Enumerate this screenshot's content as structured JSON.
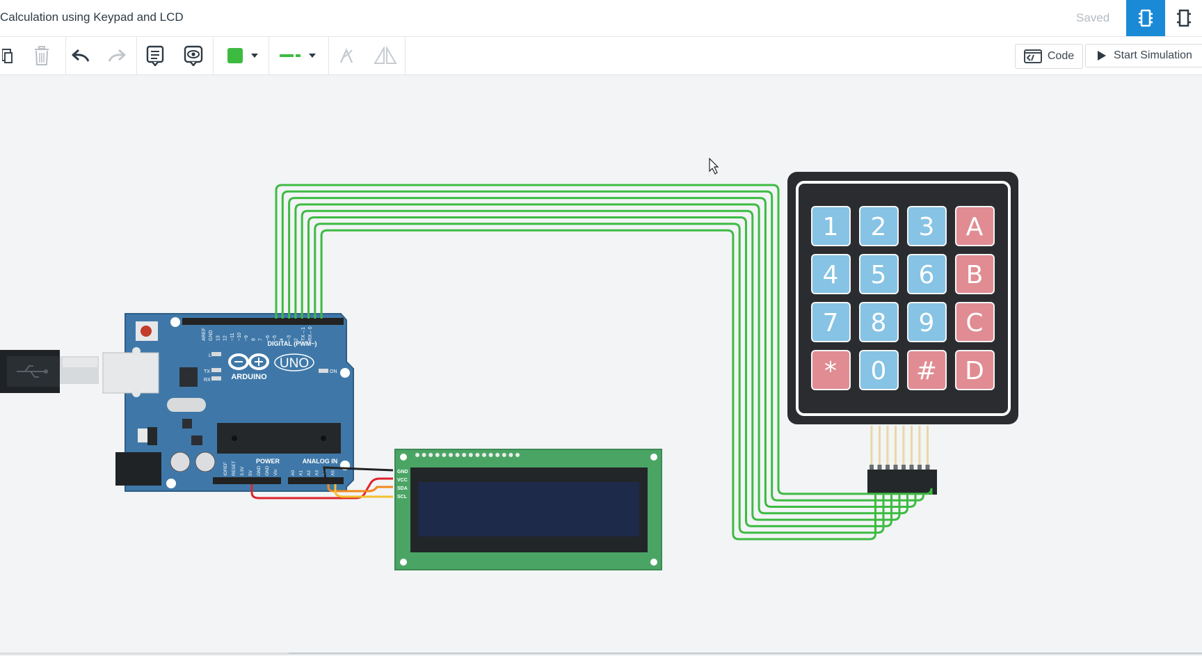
{
  "header": {
    "title": "Calculation using Keypad and LCD",
    "save_status": "Saved"
  },
  "toolbar": {
    "code_label": "Code",
    "simulate_label": "Start Simulation",
    "fill_color": "#3dbb41",
    "wire_color": "#3dbb41"
  },
  "arduino": {
    "brand": "ARDUINO",
    "model": "UNO",
    "digital_label": "DIGITAL (PWM~)",
    "power_label": "POWER",
    "analog_label": "ANALOG IN",
    "led_l": "L",
    "led_tx": "TX",
    "led_rx": "RX",
    "on_label": "ON",
    "digital_pins": [
      "AREF",
      "GND",
      "13",
      "12",
      "~11",
      "~10",
      "~9",
      "8",
      "7",
      "~6",
      "~5",
      "4",
      "~3",
      "2",
      "TX→1",
      "RX←0"
    ],
    "power_pins": [
      "IOREF",
      "RESET",
      "3.3V",
      "5V",
      "GND",
      "GND",
      "Vin"
    ],
    "analog_pins": [
      "A0",
      "A1",
      "A2",
      "A3",
      "A4",
      "A5"
    ]
  },
  "lcd": {
    "pins": [
      "GND",
      "VCC",
      "SDA",
      "SCL"
    ]
  },
  "keypad": {
    "keys": [
      "1",
      "2",
      "3",
      "A",
      "4",
      "5",
      "6",
      "B",
      "7",
      "8",
      "9",
      "C",
      "*",
      "0",
      "#",
      "D"
    ]
  },
  "colors": {
    "accent_blue": "#1a8ad6",
    "wire_green": "#3dbb41",
    "wire_red": "#e0232a",
    "wire_yellow": "#f2c12e",
    "wire_orange": "#f08a1c",
    "wire_black": "#222222",
    "board_blue": "#3f78a8",
    "key_blue": "#86c3e4",
    "key_red": "#e08c92",
    "lcd_green": "#4aa565",
    "lcd_screen": "#1d2a4a"
  }
}
